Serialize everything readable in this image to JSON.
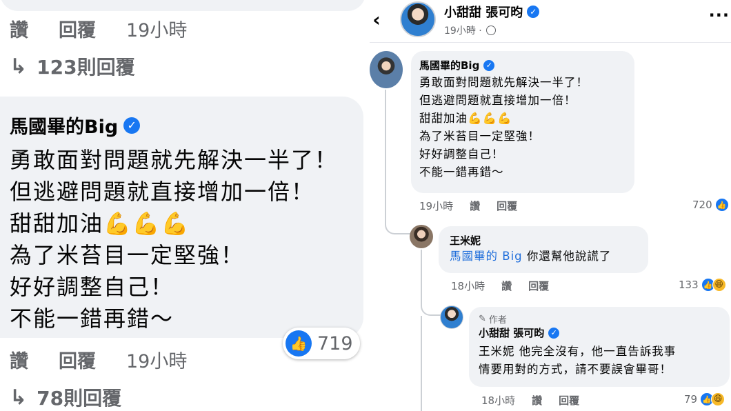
{
  "left": {
    "top_meta": {
      "like": "讚",
      "reply": "回覆",
      "time": "19小時"
    },
    "replies_top": "123則回覆",
    "comment": {
      "author": "馬國畢的Big",
      "lines": [
        "勇敢面對問題就先解決一半了！",
        "但逃避問題就直接增加一倍！",
        "甜甜加油",
        "為了米苔目一定堅強！",
        "好好調整自己！",
        "不能一錯再錯～"
      ],
      "emoji": "💪💪💪",
      "likes": "719"
    },
    "bottom_meta": {
      "like": "讚",
      "reply": "回覆",
      "time": "19小時"
    },
    "replies_bottom": "78則回覆"
  },
  "right": {
    "header": {
      "back": "‹",
      "title": "小甜甜 張可昀",
      "time": "19小時 ·",
      "more": "···"
    },
    "comment1": {
      "author": "馬國畢的Big",
      "lines": [
        "勇敢面對問題就先解決一半了！",
        "但逃避問題就直接增加一倍！",
        "甜甜加油",
        "為了米苔目一定堅強！",
        "好好調整自己！",
        "不能一錯再錯～"
      ],
      "emoji": "💪💪💪",
      "time": "19小時",
      "like": "讚",
      "reply": "回覆",
      "likes": "720"
    },
    "comment2": {
      "author": "王米妮",
      "mention": "馬國畢的 Big",
      "text": " 你還幫他說謊了",
      "time": "18小時",
      "like": "讚",
      "reply": "回覆",
      "likes": "133"
    },
    "comment3": {
      "author_tag": "作者",
      "author": "小甜甜 張可昀",
      "line1": "王米妮 他完全沒有，他一直告訴我事",
      "line2": "情要用對的方式，請不要誤會畢哥！",
      "time": "18小時",
      "like": "讚",
      "reply": "回覆",
      "likes": "79"
    }
  },
  "colors": {
    "accent": "#1877f2",
    "bubble": "#f0f2f5",
    "muted": "#65676b",
    "mention": "#216fdb"
  }
}
